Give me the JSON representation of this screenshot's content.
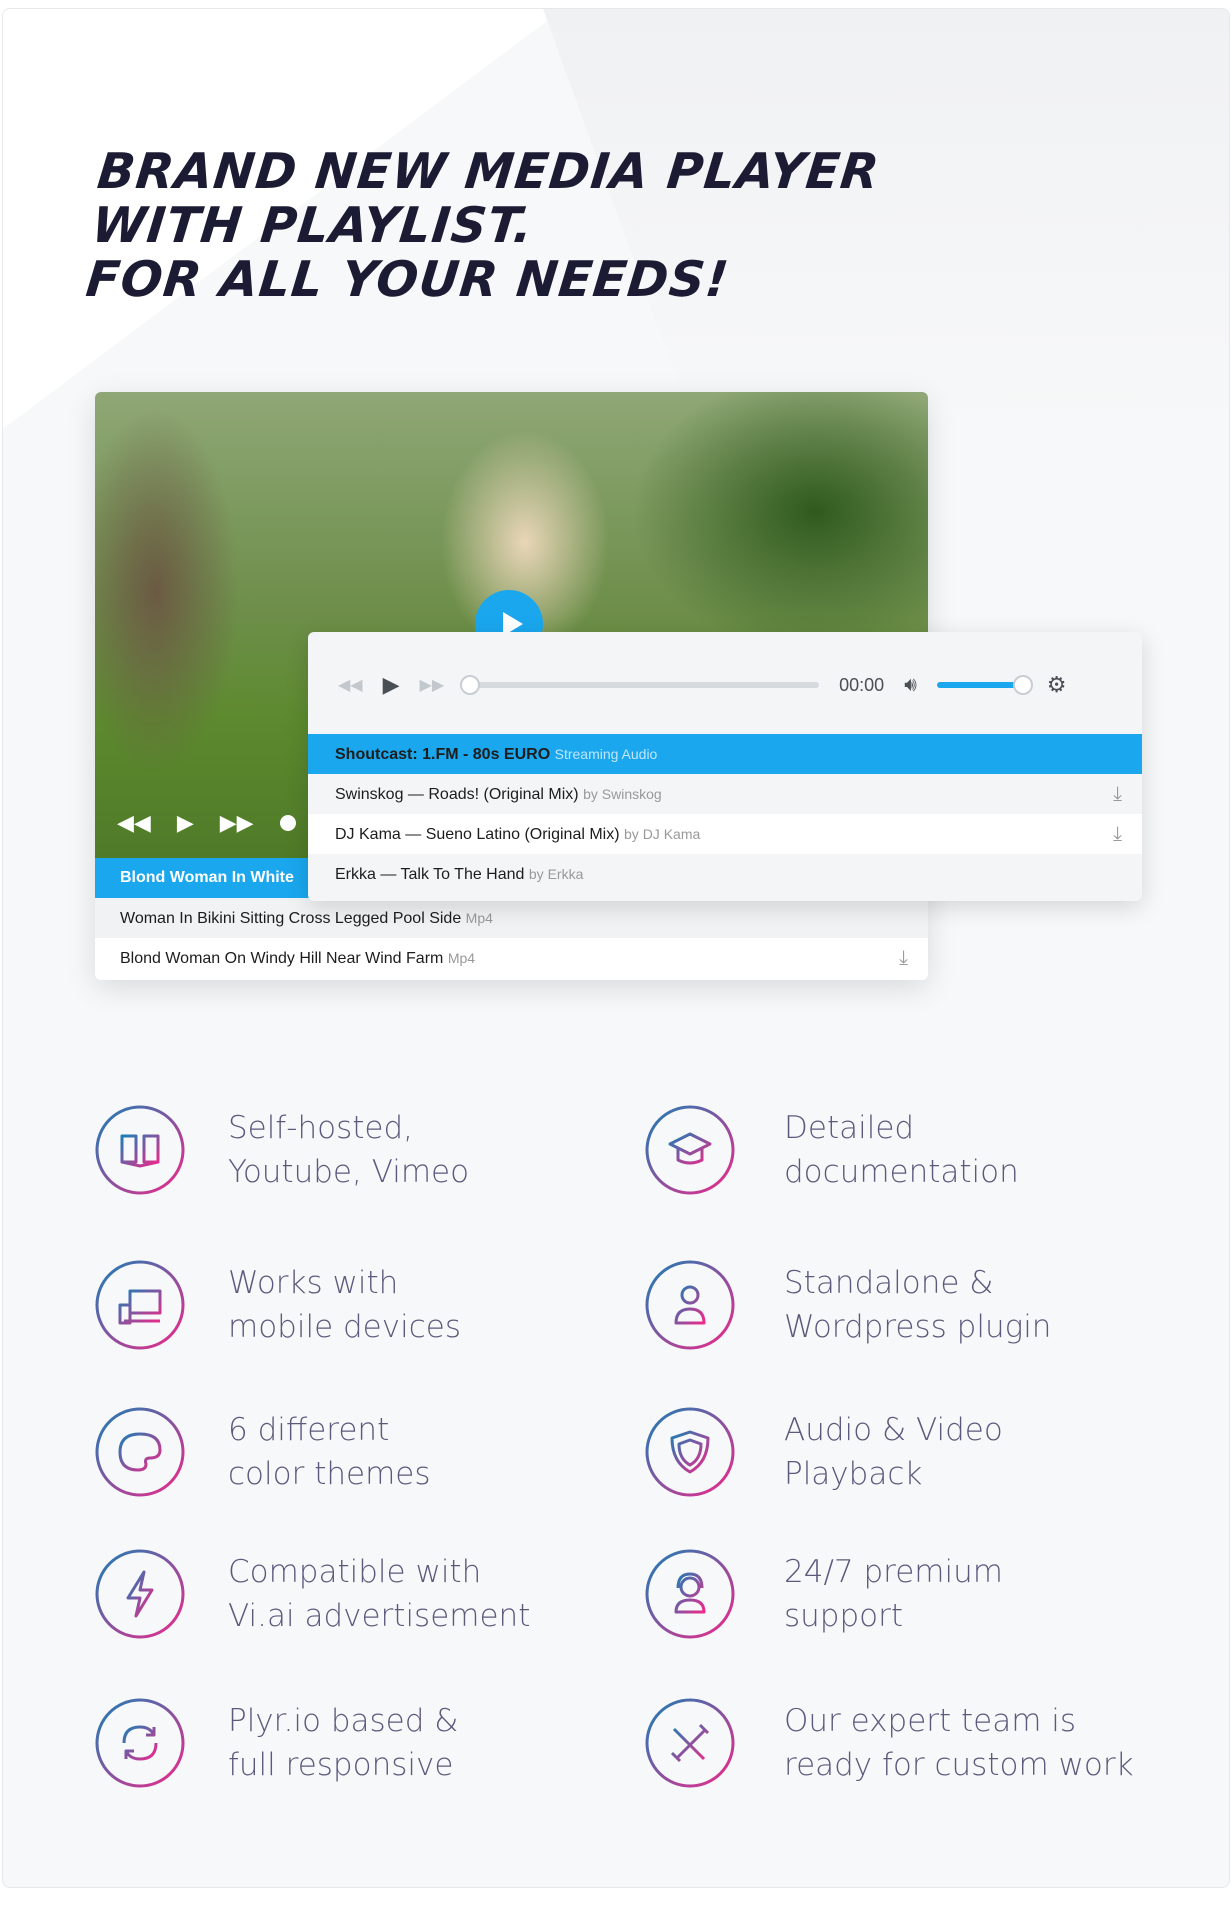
{
  "headline": {
    "line1": "BRAND NEW MEDIA PLAYER",
    "line2": "WITH PLAYLIST.",
    "line3": "FOR ALL YOUR NEEDS!"
  },
  "video_player": {
    "playlist": [
      {
        "title": "Blond Woman In White",
        "active": true
      },
      {
        "title": "Woman In Bikini Sitting Cross Legged Pool Side",
        "format": "Mp4"
      },
      {
        "title": "Blond Woman On Windy Hill Near Wind Farm",
        "format": "Mp4",
        "download": true
      }
    ]
  },
  "audio_player": {
    "time": "00:00",
    "progress": 0,
    "volume": 0.9,
    "playlist": [
      {
        "title": "Shoutcast: 1.FM - 80s EURO",
        "sub": "Streaming Audio",
        "active": true
      },
      {
        "title": "Swinskog — Roads! (Original Mix)",
        "sub": "by Swinskog",
        "download": true
      },
      {
        "title": "DJ Kama — Sueno Latino (Original Mix)",
        "sub": "by DJ Kama",
        "download": true
      },
      {
        "title": "Erkka — Talk To The Hand",
        "sub": "by Erkka"
      }
    ]
  },
  "features": [
    {
      "icon": "book-icon",
      "line1": "Self-hosted,",
      "line2": "Youtube, Vimeo"
    },
    {
      "icon": "graduation-cap-icon",
      "line1": "Detailed",
      "line2": "documentation"
    },
    {
      "icon": "devices-icon",
      "line1": "Works with",
      "line2": "mobile devices"
    },
    {
      "icon": "user-icon",
      "line1": "Standalone &",
      "line2": "Wordpress plugin"
    },
    {
      "icon": "palette-icon",
      "line1": "6 different",
      "line2": "color themes"
    },
    {
      "icon": "shield-icon",
      "line1": "Audio & Video",
      "line2": "Playback"
    },
    {
      "icon": "lightning-icon",
      "line1": "Compatible with",
      "line2": "Vi.ai advertisement"
    },
    {
      "icon": "headset-icon",
      "line1": "24/7 premium",
      "line2": "support"
    },
    {
      "icon": "refresh-icon",
      "line1": "Plyr.io based &",
      "line2": "full responsive"
    },
    {
      "icon": "tools-icon",
      "line1": "Our expert team is",
      "line2": "ready for custom work"
    }
  ],
  "colors": {
    "accent": "#1aa7ee",
    "gradient_start": "#1a7fb5",
    "gradient_end": "#f0288a",
    "text": "#5b5a7d",
    "headline": "#1b1b33"
  }
}
